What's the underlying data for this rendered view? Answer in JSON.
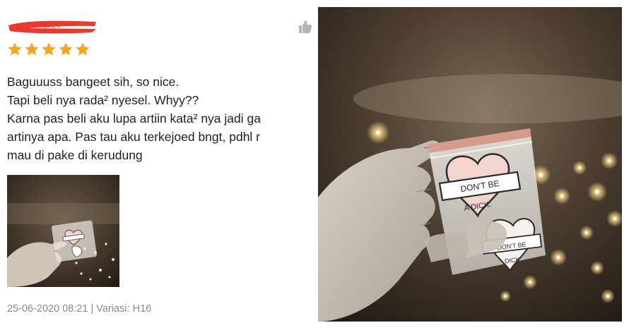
{
  "review": {
    "rating_stars": 5,
    "rating_max": 5,
    "star_color": "#f5a623",
    "username_partial": "1120",
    "lines": [
      "Baguuuss bangeet sih, so nice.",
      "Tapi beli nya rada² nyesel. Whyy??",
      "Karna pas beli aku lupa artiin kata² nya jadi ga",
      "artinya apa. Pas tau aku terkejoed bngt, pdhl r",
      "mau di pake di kerudung"
    ],
    "date": "25-06-2020 08:21",
    "separator": "|",
    "variant_label": "Variasi:",
    "variant_value": "H16"
  },
  "photo": {
    "pin_text_top": "DON'T BE",
    "pin_text_bottom": "A DICK.",
    "pin_text_small": "DON'T BE",
    "pin_text_small_bottom": "DICK."
  },
  "icons": {
    "like": "thumbs-up-icon",
    "star": "star-icon"
  }
}
